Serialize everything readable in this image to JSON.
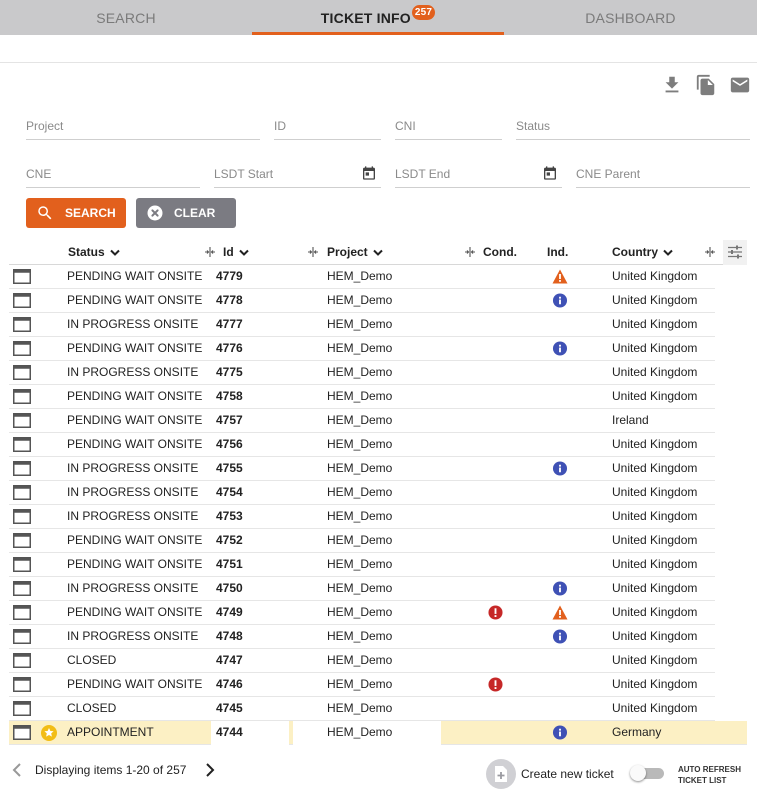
{
  "tabs": [
    {
      "label": "SEARCH"
    },
    {
      "label": "TICKET INFO",
      "badge": "257"
    },
    {
      "label": "DASHBOARD"
    }
  ],
  "toolbar": {
    "icons": [
      "download-icon",
      "copy-icon",
      "email-icon"
    ]
  },
  "filters": {
    "project": {
      "placeholder": "Project",
      "value": ""
    },
    "id": {
      "placeholder": "ID",
      "value": ""
    },
    "cni": {
      "placeholder": "CNI",
      "value": ""
    },
    "status": {
      "placeholder": "Status",
      "value": ""
    },
    "cne": {
      "placeholder": "CNE",
      "value": ""
    },
    "lsdt_start": {
      "placeholder": "LSDT Start",
      "value": ""
    },
    "lsdt_end": {
      "placeholder": "LSDT End",
      "value": ""
    },
    "cne_parent": {
      "placeholder": "CNE Parent",
      "value": ""
    }
  },
  "buttons": {
    "search": "SEARCH",
    "clear": "CLEAR"
  },
  "colors": {
    "accent": "#e2601d",
    "clear": "#7b7b82",
    "highlight": "#fcf0c4",
    "info": "#3f51b5",
    "error": "#c62828",
    "warning": "#e2601d"
  },
  "table": {
    "columns": {
      "status": "Status",
      "id": "Id",
      "project": "Project",
      "cond": "Cond.",
      "ind": "Ind.",
      "country": "Country"
    },
    "rows": [
      {
        "status": "PENDING WAIT ONSITE",
        "id": "4779",
        "project": "HEM_Demo",
        "cond": "",
        "ind": "warning",
        "country": "United Kingdom"
      },
      {
        "status": "PENDING WAIT ONSITE",
        "id": "4778",
        "project": "HEM_Demo",
        "cond": "",
        "ind": "info",
        "country": "United Kingdom"
      },
      {
        "status": "IN PROGRESS ONSITE",
        "id": "4777",
        "project": "HEM_Demo",
        "cond": "",
        "ind": "",
        "country": "United Kingdom"
      },
      {
        "status": "PENDING WAIT ONSITE",
        "id": "4776",
        "project": "HEM_Demo",
        "cond": "",
        "ind": "info",
        "country": "United Kingdom"
      },
      {
        "status": "IN PROGRESS ONSITE",
        "id": "4775",
        "project": "HEM_Demo",
        "cond": "",
        "ind": "",
        "country": "United Kingdom"
      },
      {
        "status": "PENDING WAIT ONSITE",
        "id": "4758",
        "project": "HEM_Demo",
        "cond": "",
        "ind": "",
        "country": "United Kingdom"
      },
      {
        "status": "PENDING WAIT ONSITE",
        "id": "4757",
        "project": "HEM_Demo",
        "cond": "",
        "ind": "",
        "country": "Ireland"
      },
      {
        "status": "PENDING WAIT ONSITE",
        "id": "4756",
        "project": "HEM_Demo",
        "cond": "",
        "ind": "",
        "country": "United Kingdom"
      },
      {
        "status": "IN PROGRESS ONSITE",
        "id": "4755",
        "project": "HEM_Demo",
        "cond": "",
        "ind": "info",
        "country": "United Kingdom"
      },
      {
        "status": "IN PROGRESS ONSITE",
        "id": "4754",
        "project": "HEM_Demo",
        "cond": "",
        "ind": "",
        "country": "United Kingdom"
      },
      {
        "status": "IN PROGRESS ONSITE",
        "id": "4753",
        "project": "HEM_Demo",
        "cond": "",
        "ind": "",
        "country": "United Kingdom"
      },
      {
        "status": "PENDING WAIT ONSITE",
        "id": "4752",
        "project": "HEM_Demo",
        "cond": "",
        "ind": "",
        "country": "United Kingdom"
      },
      {
        "status": "PENDING WAIT ONSITE",
        "id": "4751",
        "project": "HEM_Demo",
        "cond": "",
        "ind": "",
        "country": "United Kingdom"
      },
      {
        "status": "IN PROGRESS ONSITE",
        "id": "4750",
        "project": "HEM_Demo",
        "cond": "",
        "ind": "info",
        "country": "United Kingdom"
      },
      {
        "status": "PENDING WAIT ONSITE",
        "id": "4749",
        "project": "HEM_Demo",
        "cond": "error",
        "ind": "warning",
        "country": "United Kingdom"
      },
      {
        "status": "IN PROGRESS ONSITE",
        "id": "4748",
        "project": "HEM_Demo",
        "cond": "",
        "ind": "info",
        "country": "United Kingdom"
      },
      {
        "status": "CLOSED",
        "id": "4747",
        "project": "HEM_Demo",
        "cond": "",
        "ind": "",
        "country": "United Kingdom"
      },
      {
        "status": "PENDING WAIT ONSITE",
        "id": "4746",
        "project": "HEM_Demo",
        "cond": "error",
        "ind": "",
        "country": "United Kingdom"
      },
      {
        "status": "CLOSED",
        "id": "4745",
        "project": "HEM_Demo",
        "cond": "",
        "ind": "",
        "country": "United Kingdom"
      },
      {
        "status": "APPOINTMENT",
        "id": "4744",
        "project": "HEM_Demo",
        "cond": "",
        "ind": "info",
        "country": "Germany",
        "highlighted": true,
        "starred": true
      }
    ]
  },
  "footer": {
    "pager_text": "Displaying items 1-20 of 257",
    "create_label": "Create new ticket",
    "auto_refresh_label": "AUTO REFRESH TICKET LIST",
    "auto_refresh_on": false
  }
}
